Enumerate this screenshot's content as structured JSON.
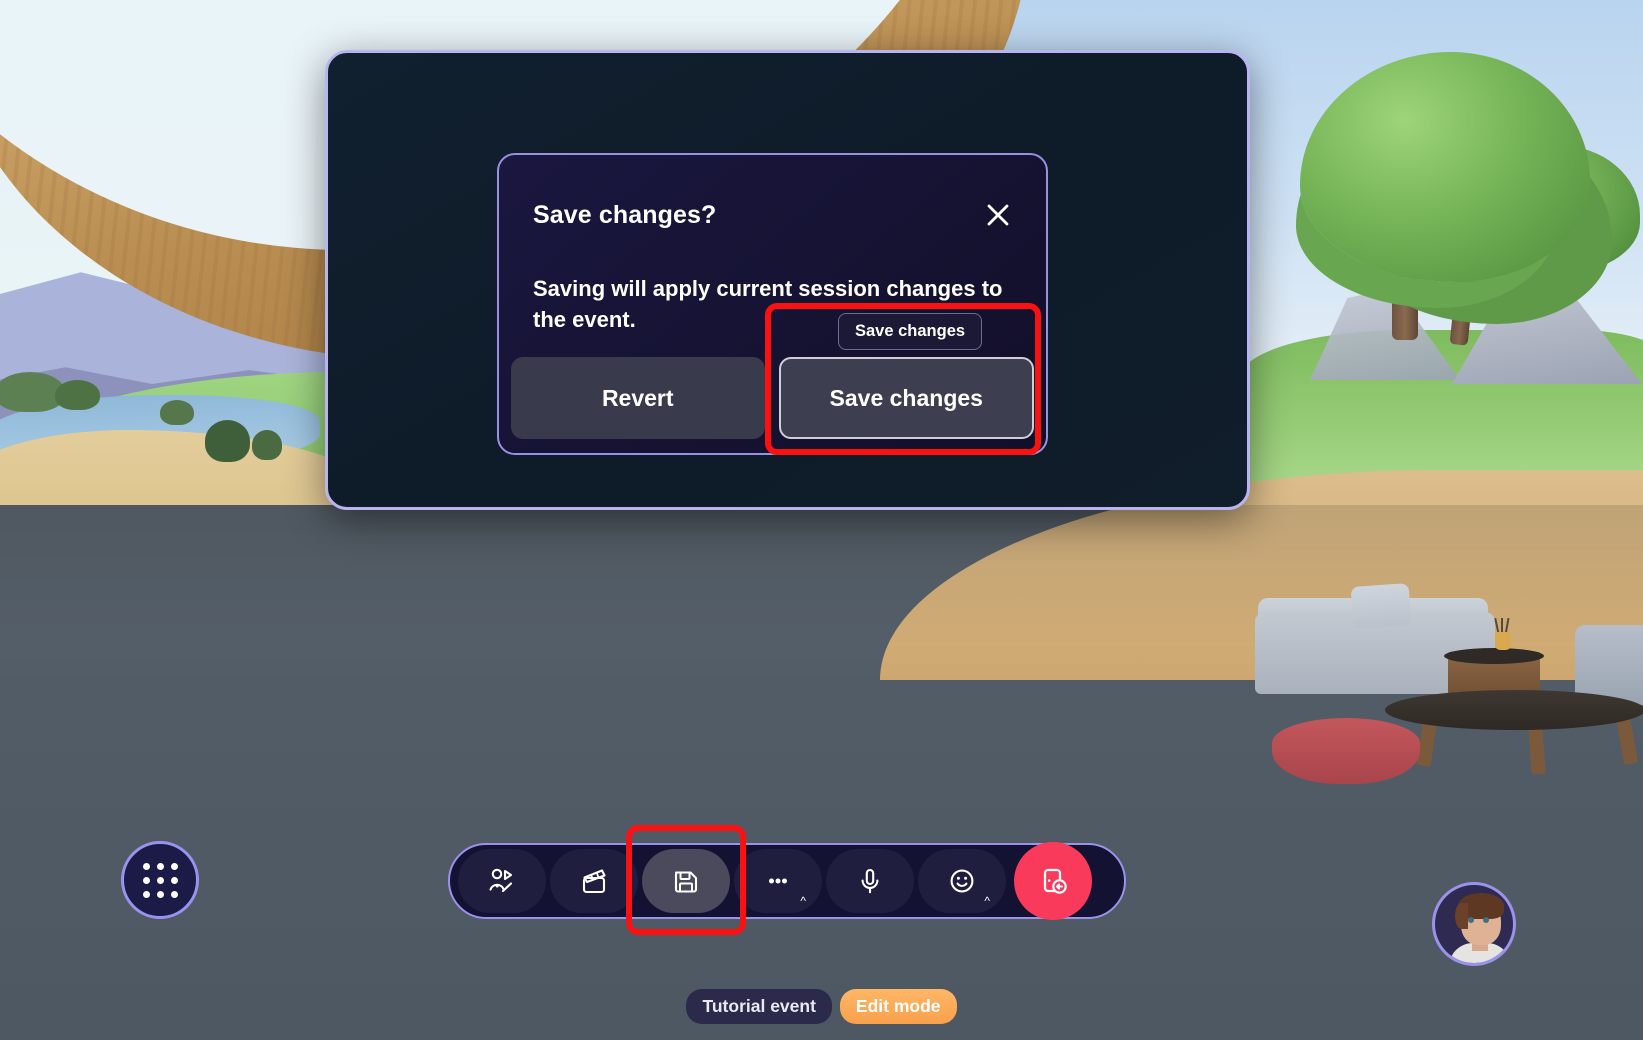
{
  "app": {
    "scene_name": "virtual-immersive-space"
  },
  "dialog": {
    "title": "Save changes?",
    "body": "Saving will apply current session changes to the event.",
    "close_icon": "close-x-icon",
    "revert_label": "Revert",
    "save_label": "Save changes",
    "tooltip_label": "Save changes"
  },
  "toolbar": {
    "buttons": [
      {
        "name": "customize-avatar-button",
        "icon": "avatar-edit-icon",
        "label": "",
        "caret": "",
        "active": false
      },
      {
        "name": "clapperboard-button",
        "icon": "clapperboard-icon",
        "label": "",
        "caret": "",
        "active": false
      },
      {
        "name": "save-button",
        "icon": "floppy-save-icon",
        "label": "",
        "caret": "",
        "active": true
      },
      {
        "name": "more-options-button",
        "icon": "ellipsis-icon",
        "label": "",
        "caret": "^",
        "active": false
      },
      {
        "name": "microphone-button",
        "icon": "microphone-icon",
        "label": "",
        "caret": "",
        "active": false
      },
      {
        "name": "reactions-button",
        "icon": "smiley-face-icon",
        "label": "",
        "caret": "^",
        "active": false
      },
      {
        "name": "leave-event-button",
        "icon": "leave-door-icon",
        "label": "",
        "caret": "",
        "active": false
      }
    ]
  },
  "launcher": {
    "name": "app-launcher-button",
    "icon": "nine-dot-grid-icon"
  },
  "badges": {
    "event_name": "Tutorial event",
    "mode": "Edit mode"
  },
  "avatar": {
    "name": "user-avatar"
  },
  "colors": {
    "panel_border": "#b7b4ef",
    "panel_bg": "#11202f",
    "dialog_bg": "#161334",
    "dialog_border": "#9a8fe0",
    "annotation_red": "#fb1111",
    "leave_button": "#f93a5a",
    "edit_mode_badge": "#f9a04c",
    "primary_button_border": "#cfcfd8"
  }
}
